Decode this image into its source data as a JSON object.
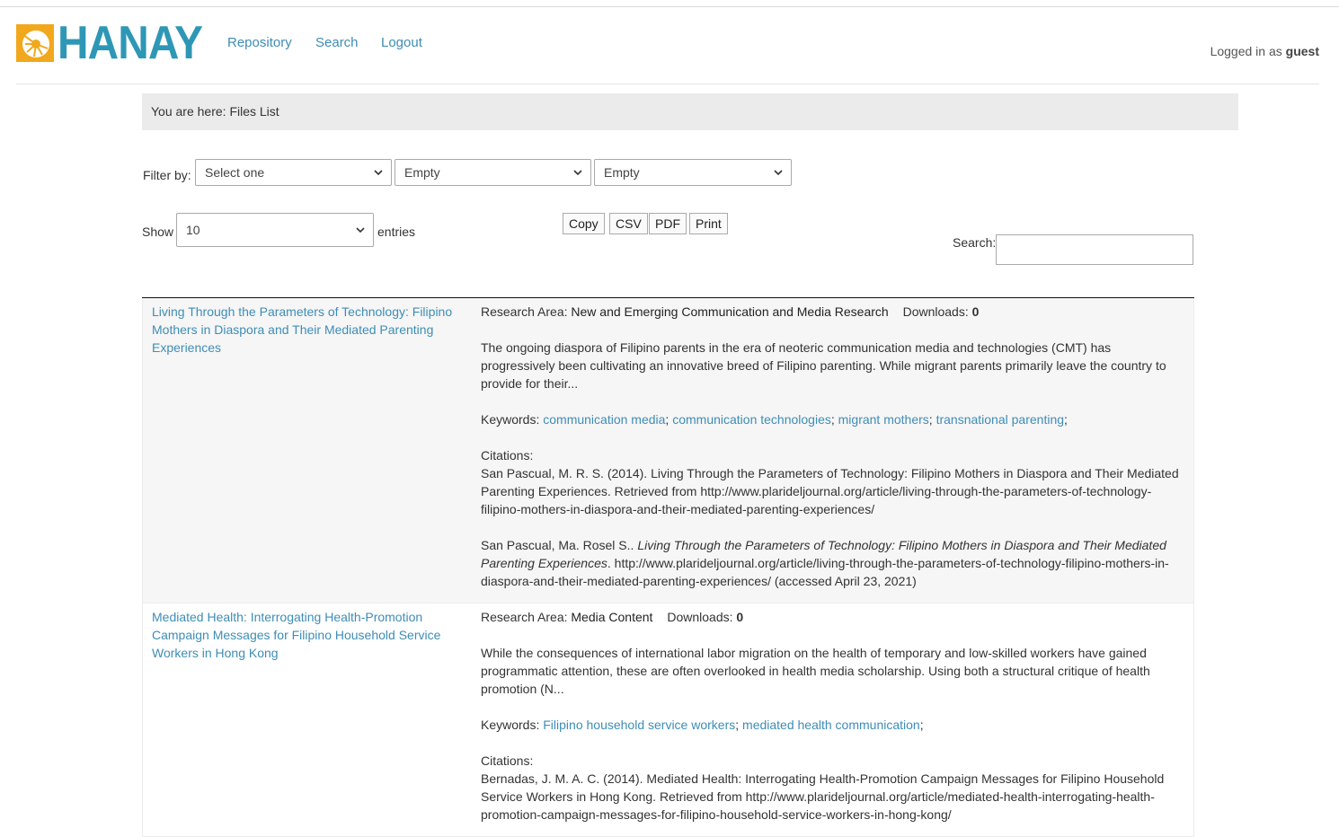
{
  "header": {
    "logo_text": "HANAY",
    "nav": [
      "Repository",
      "Search",
      "Logout"
    ],
    "logged_in_prefix": "Logged in as",
    "logged_in_user": "guest"
  },
  "breadcrumb": "You are here: Files List",
  "filter": {
    "label": "Filter by:",
    "selects": [
      "Select one",
      "Empty",
      "Empty"
    ]
  },
  "show": {
    "label": "Show",
    "value": "10",
    "suffix": "entries"
  },
  "buttons": [
    "Copy",
    "CSV",
    "PDF",
    "Print"
  ],
  "search": {
    "label": "Search:",
    "value": ""
  },
  "records": [
    {
      "title": "Living Through the Parameters of Technology: Filipino Mothers in Diaspora and Their Mediated Parenting Experiences",
      "research_area_label": "Research Area:",
      "research_area": "New and Emerging Communication and Media Research",
      "downloads_label": "Downloads:",
      "downloads": "0",
      "abstract": "The ongoing diaspora of Filipino parents in the era of neoteric communication media and technologies (CMT) has progressively been cultivating an innovative breed of Filipino parenting. While migrant parents primarily leave the country to provide for their...",
      "keywords_label": "Keywords:",
      "keywords": [
        "communication media",
        "communication technologies",
        "migrant mothers",
        "transnational parenting"
      ],
      "citations_label": "Citations:",
      "citation_apa": "San Pascual, M. R. S. (2014). Living Through the Parameters of Technology: Filipino Mothers in Diaspora and Their Mediated Parenting Experiences. Retrieved from http://www.plarideljournal.org/article/living-through-the-parameters-of-technology-filipino-mothers-in-diaspora-and-their-mediated-parenting-experiences/",
      "citation_chicago_author": "San Pascual, Ma. Rosel S..",
      "citation_chicago_title": "Living Through the Parameters of Technology: Filipino Mothers in Diaspora and Their Mediated Parenting Experiences",
      "citation_chicago_rest": ". http://www.plarideljournal.org/article/living-through-the-parameters-of-technology-filipino-mothers-in-diaspora-and-their-mediated-parenting-experiences/ (accessed April 23, 2021)"
    },
    {
      "title": "Mediated Health: Interrogating Health-Promotion Campaign Messages for Filipino Household Service Workers in Hong Kong",
      "research_area_label": "Research Area:",
      "research_area": "Media Content",
      "downloads_label": "Downloads:",
      "downloads": "0",
      "abstract": "While the consequences of international labor migration on the health of temporary and low-skilled workers have gained programmatic attention, these are often overlooked in health media scholarship. Using both a structural critique of health promotion (N...",
      "keywords_label": "Keywords:",
      "keywords": [
        "Filipino household service workers",
        "mediated health communication"
      ],
      "citations_label": "Citations:",
      "citation_apa": "Bernadas, J. M. A. C. (2014). Mediated Health: Interrogating Health-Promotion Campaign Messages for Filipino Household Service Workers in Hong Kong. Retrieved from http://www.plarideljournal.org/article/mediated-health-interrogating-health-promotion-campaign-messages-for-filipino-household-service-workers-in-hong-kong/"
    }
  ],
  "colors": {
    "link": "#3e8db5",
    "logo_blue": "#2e97b6",
    "logo_orange": "#f2a81d",
    "breadcrumb_bg": "#ebebeb"
  }
}
